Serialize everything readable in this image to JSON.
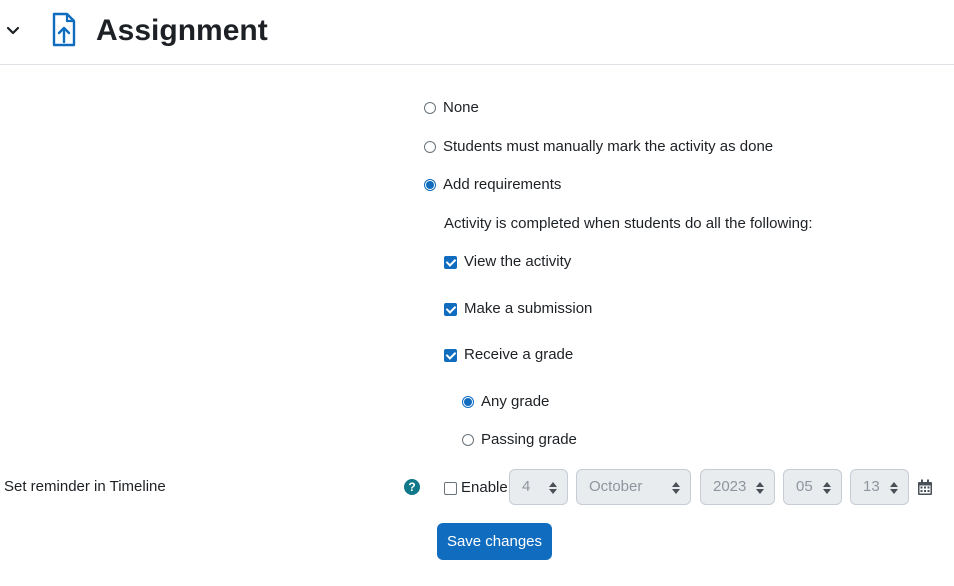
{
  "header": {
    "title": "Assignment",
    "collapse_icon": "chevron-down-icon",
    "module_icon": "assignment-upload-icon",
    "accent_color": "#0f6cbf"
  },
  "completion": {
    "options": [
      {
        "label": "None",
        "selected": false
      },
      {
        "label": "Students must manually mark the activity as done",
        "selected": false
      },
      {
        "label": "Add requirements",
        "selected": true
      }
    ],
    "requirements_intro": "Activity is completed when students do all the following:",
    "requirements": [
      {
        "label": "View the activity",
        "checked": true
      },
      {
        "label": "Make a submission",
        "checked": true
      },
      {
        "label": "Receive a grade",
        "checked": true
      }
    ],
    "grade_options": [
      {
        "label": "Any grade",
        "selected": true
      },
      {
        "label": "Passing grade",
        "selected": false
      }
    ]
  },
  "reminder": {
    "label": "Set reminder in Timeline",
    "help_icon": "question-circle-icon",
    "enable_label": "Enable",
    "enabled": false,
    "day": "4",
    "month": "October",
    "year": "2023",
    "hour": "05",
    "minute": "13",
    "calendar_icon": "calendar-icon"
  },
  "actions": {
    "save_label": "Save changes"
  }
}
